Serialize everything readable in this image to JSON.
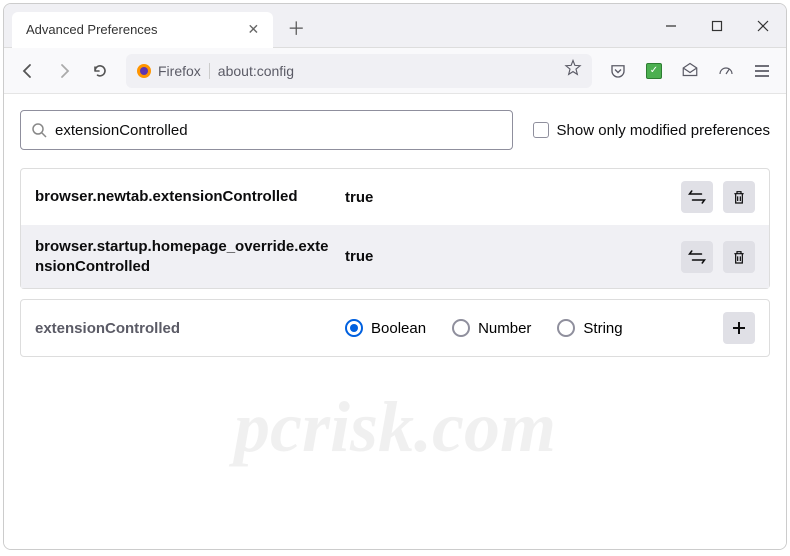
{
  "tab": {
    "title": "Advanced Preferences"
  },
  "urlbar": {
    "identity": "Firefox",
    "url": "about:config"
  },
  "search": {
    "value": "extensionControlled"
  },
  "checkbox": {
    "label": "Show only modified preferences"
  },
  "prefs": [
    {
      "name": "browser.newtab.extensionControlled",
      "value": "true"
    },
    {
      "name": "browser.startup.homepage_override.extensionControlled",
      "value": "true"
    }
  ],
  "newPref": {
    "name": "extensionControlled",
    "types": [
      {
        "label": "Boolean",
        "selected": true
      },
      {
        "label": "Number",
        "selected": false
      },
      {
        "label": "String",
        "selected": false
      }
    ]
  },
  "watermark": "pcrisk.com"
}
